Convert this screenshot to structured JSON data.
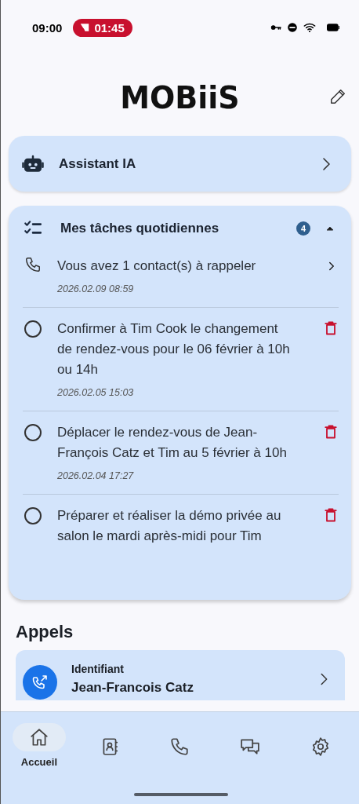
{
  "status_bar": {
    "time": "09:00",
    "cast_timer": "01:45"
  },
  "header": {
    "logo": "MOBiiS"
  },
  "assistant": {
    "label": "Assistant IA"
  },
  "tasks": {
    "title": "Mes tâches quotidiennes",
    "count": "4",
    "expanded": true,
    "items": [
      {
        "kind": "callback",
        "text": "Vous avez 1 contact(s) à rappeler",
        "date": "2026.02.09 08:59"
      },
      {
        "kind": "todo",
        "checked": false,
        "text": "Confirmer à Tim Cook le changement de rendez-vous pour le 06 février à 10h ou 14h",
        "date": "2026.02.05 15:03"
      },
      {
        "kind": "todo",
        "checked": false,
        "text": "Déplacer le rendez-vous de Jean-François Catz et Tim au 5 février à 10h",
        "date": "2026.02.04 17:27"
      },
      {
        "kind": "todo",
        "checked": false,
        "text": "Préparer et réaliser la démo privée au salon le mardi après-midi pour Tim"
      }
    ]
  },
  "calls": {
    "title": "Appels",
    "items": [
      {
        "label": "Identifiant",
        "name": "Jean-Francois Catz"
      }
    ]
  },
  "nav": [
    {
      "kind": "home",
      "label": "Accueil",
      "selected": true
    },
    {
      "kind": "contacts",
      "selected": false
    },
    {
      "kind": "phone",
      "selected": false
    },
    {
      "kind": "chat",
      "selected": false
    },
    {
      "kind": "settings",
      "selected": false
    }
  ]
}
